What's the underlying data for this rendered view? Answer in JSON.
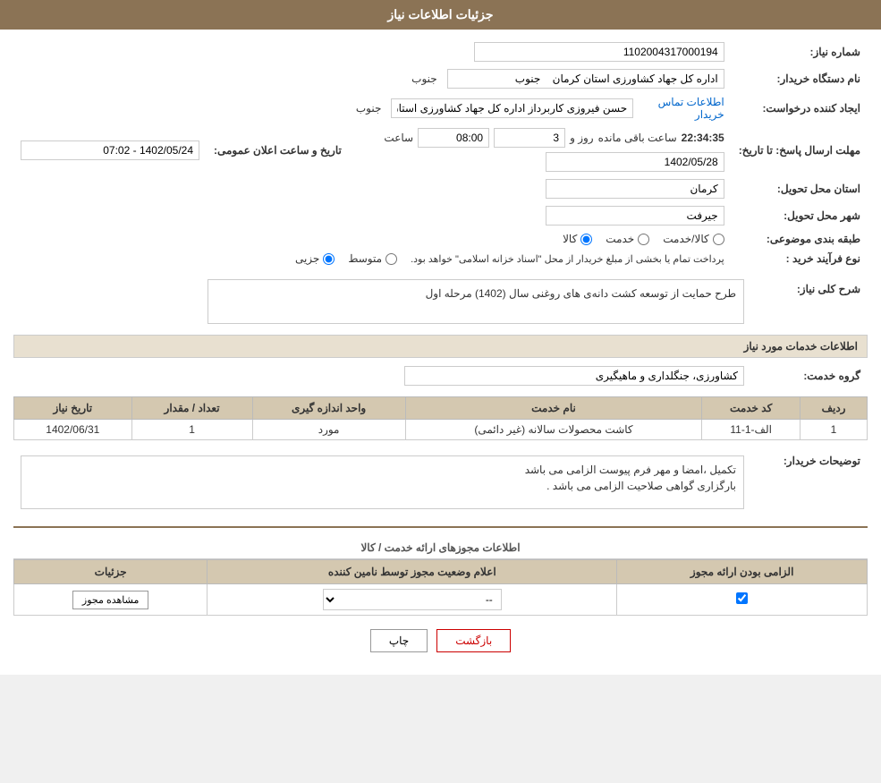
{
  "page": {
    "title": "جزئیات اطلاعات نیاز"
  },
  "header": {
    "label": "شماره نیاز:",
    "value": "1102004317000194",
    "buyer_label": "نام دستگاه خریدار:",
    "buyer_org": "اداره کل جهاد کشاورزی استان کرمان",
    "buyer_region": "جنوب",
    "requester_label": "ایجاد کننده درخواست:",
    "requester_name": "حسن فیروزی کاربرداز اداره کل جهاد کشاورزی استان کرمان",
    "requester_region": "جنوب",
    "contact_link": "اطلاعات تماس خریدار",
    "announce_label": "تاریخ و ساعت اعلان عمومی:",
    "announce_value": "1402/05/24 - 07:02",
    "deadline_label": "مهلت ارسال پاسخ: تا تاریخ:",
    "deadline_date": "1402/05/28",
    "deadline_time_label": "ساعت",
    "deadline_time": "08:00",
    "deadline_days_label": "روز و",
    "deadline_days": "3",
    "deadline_remaining_label": "ساعت باقی مانده",
    "deadline_remaining": "22:34:35",
    "province_label": "استان محل تحویل:",
    "province": "کرمان",
    "city_label": "شهر محل تحویل:",
    "city": "جیرفت",
    "category_label": "طبقه بندی موضوعی:",
    "category_kala": "کالا",
    "category_khadamat": "خدمت",
    "category_kala_khadamat": "کالا/خدمت",
    "process_label": "نوع فرآیند خرید :",
    "process_jozi": "جزیی",
    "process_mottasat": "متوسط",
    "process_description": "پرداخت تمام یا بخشی از مبلغ خریدار از محل \"اسناد خزانه اسلامی\" خواهد بود."
  },
  "need_summary": {
    "title": "شرح کلی نیاز:",
    "value": "طرح حمایت از توسعه کشت دانه‌ی های روغنی سال (1402) مرحله اول"
  },
  "services_section": {
    "title": "اطلاعات خدمات مورد نیاز",
    "service_group_label": "گروه خدمت:",
    "service_group": "کشاورزی، جنگلداری و ماهیگیری"
  },
  "services_table": {
    "columns": [
      "ردیف",
      "کد خدمت",
      "نام خدمت",
      "واحد اندازه گیری",
      "تعداد / مقدار",
      "تاریخ نیاز"
    ],
    "rows": [
      {
        "row": "1",
        "code": "الف-1-11",
        "name": "کاشت محصولات سالانه (غیر دائمی)",
        "unit": "مورد",
        "quantity": "1",
        "date": "1402/06/31"
      }
    ]
  },
  "buyer_notes_label": "توضیحات خریدار:",
  "buyer_notes_line1": "تکمیل ،امضا و مهر فرم پیوست الزامی می باشد",
  "buyer_notes_line2": "بارگزاری گواهی صلاحیت الزامی می باشد .",
  "permissions_section": {
    "title": "اطلاعات مجوزهای ارائه خدمت / کالا",
    "table_columns": [
      "الزامی بودن ارائه مجوز",
      "اعلام وضعیت مجوز توسط نامین کننده",
      "جزئیات"
    ],
    "rows": [
      {
        "required": true,
        "status": "--",
        "details_btn": "مشاهده مجوز"
      }
    ]
  },
  "buttons": {
    "print": "چاپ",
    "back": "بازگشت"
  }
}
